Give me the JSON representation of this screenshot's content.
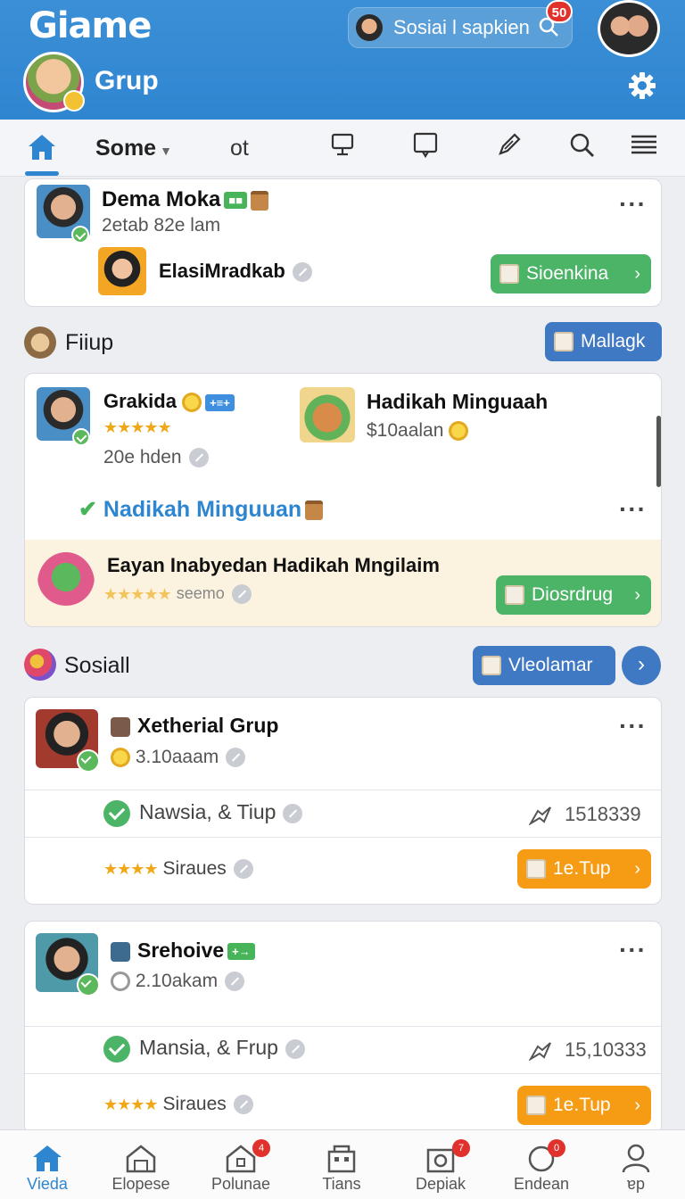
{
  "header": {
    "app_title": "Giame",
    "group_label": "Grup",
    "search_text": "Sosiai l sapkien",
    "notif_count": "50",
    "accent": "#2f86d0"
  },
  "tabs": {
    "some": "Some",
    "ot": "ot"
  },
  "feed": {
    "card1": {
      "name": "Dema Moka",
      "meta": "2etab 82e lam",
      "sub_name": "ElasiMradkab",
      "button": "Sioenkina"
    },
    "section_fiiup": {
      "title": "Fiiup",
      "button": "Mallagk"
    },
    "card2": {
      "name_left": "Grakida",
      "meta_left": "20e hden",
      "name_right": "Hadikah Minguaah",
      "meta_right": "$10aalan",
      "headline": "Nadikah Minguuan",
      "promo_title": "Eayan Inabyedan Hadikah Mngilaim",
      "promo_meta": "seemo",
      "promo_button": "Diosrdrug"
    },
    "section_sosiall": {
      "title": "Sosiall",
      "button": "Vleolamar"
    },
    "card3": {
      "name": "Xetherial Grup",
      "meta": "3.10aaam",
      "row1": "Nawsia, & Tiup",
      "row1_count": "1518339",
      "row2": "Siraues",
      "button": "1e.Tup"
    },
    "card4": {
      "name": "Srehoive",
      "meta": "2.10akam",
      "row1": "Mansia, & Frup",
      "row1_count": "15,10333",
      "row2": "Siraues",
      "button": "1e.Tup"
    }
  },
  "bottom_nav": [
    {
      "label": "Vieda",
      "badge": ""
    },
    {
      "label": "Elopese",
      "badge": ""
    },
    {
      "label": "Polunae",
      "badge": "4"
    },
    {
      "label": "Tians",
      "badge": ""
    },
    {
      "label": "Depiak",
      "badge": "7"
    },
    {
      "label": "Endean",
      "badge": "0"
    },
    {
      "label": "ɐp",
      "badge": ""
    }
  ]
}
